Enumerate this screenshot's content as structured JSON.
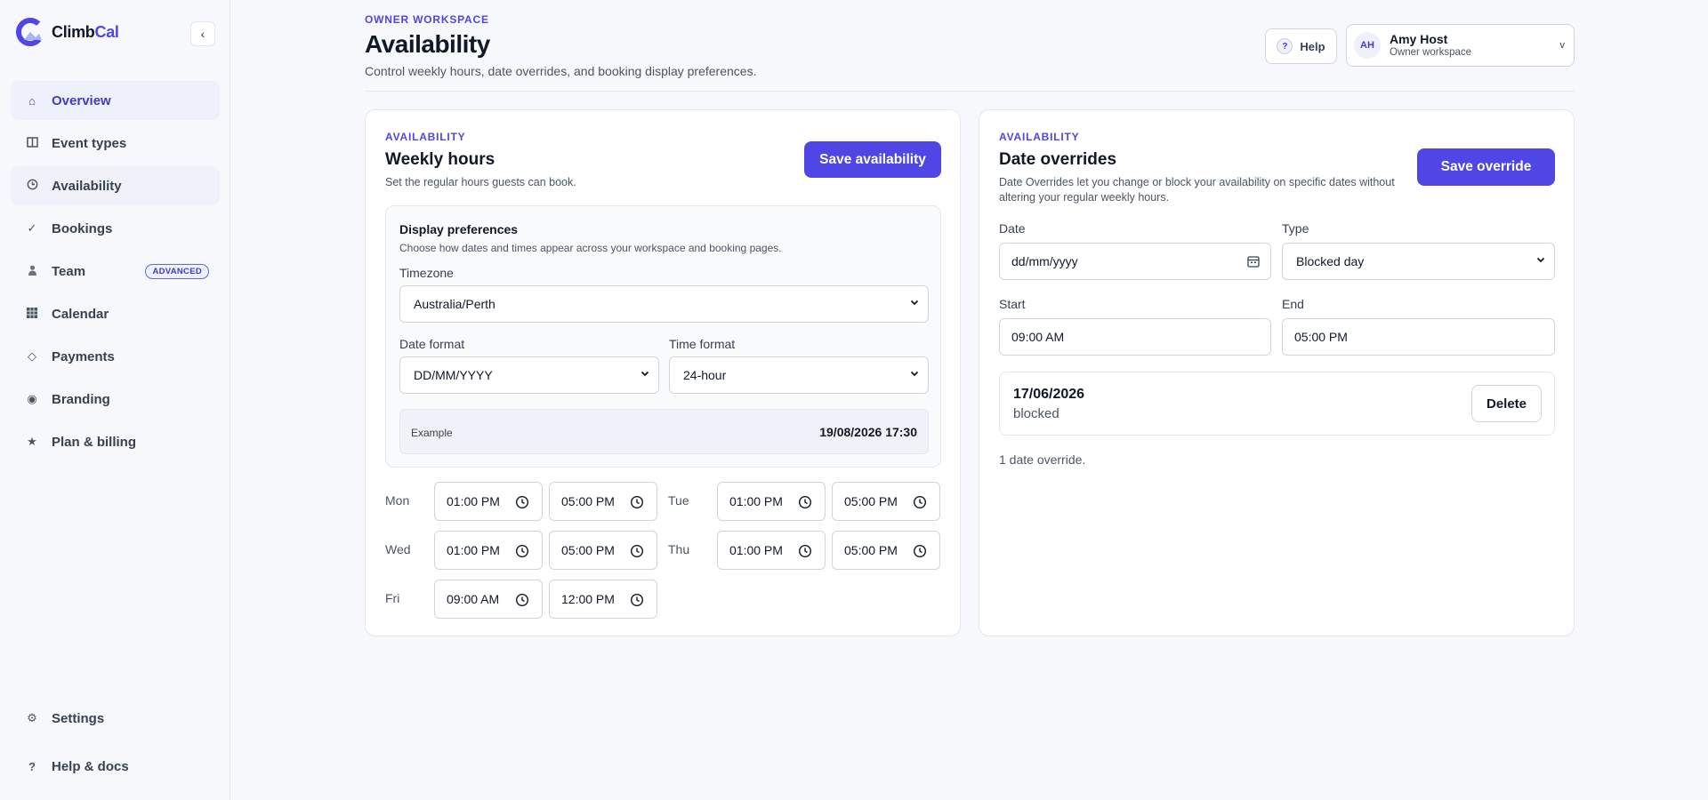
{
  "brand": {
    "name_part1": "Climb",
    "name_part2": "Cal",
    "collapse_icon": "chevron-left-icon"
  },
  "sidebar": {
    "items": [
      {
        "label": "Overview",
        "icon": "home-icon",
        "state": "active"
      },
      {
        "label": "Event types",
        "icon": "book-icon"
      },
      {
        "label": "Availability",
        "icon": "clock-icon",
        "state": "selected"
      },
      {
        "label": "Bookings",
        "icon": "check-icon"
      },
      {
        "label": "Team",
        "icon": "user-icon",
        "badge": "ADVANCED"
      },
      {
        "label": "Calendar",
        "icon": "grid-icon"
      },
      {
        "label": "Payments",
        "icon": "diamond-icon"
      },
      {
        "label": "Branding",
        "icon": "target-icon"
      },
      {
        "label": "Plan & billing",
        "icon": "star-icon"
      }
    ],
    "bottom_items": [
      {
        "label": "Settings",
        "icon": "gear-icon"
      },
      {
        "label": "Help & docs",
        "icon": "question-icon"
      }
    ]
  },
  "header": {
    "eyebrow": "OWNER WORKSPACE",
    "title": "Availability",
    "subtitle": "Control weekly hours, date overrides, and booking display preferences.",
    "help_label": "Help",
    "help_glyph": "?",
    "account": {
      "initials": "AH",
      "name": "Amy Host",
      "role": "Owner workspace",
      "chevron": "v"
    }
  },
  "weekly": {
    "eyebrow": "AVAILABILITY",
    "title": "Weekly hours",
    "description": "Set the regular hours guests can book.",
    "save_label": "Save availability",
    "prefs": {
      "title": "Display preferences",
      "description": "Choose how dates and times appear across your workspace and booking pages.",
      "timezone_label": "Timezone",
      "timezone_value": "Australia/Perth",
      "date_format_label": "Date format",
      "date_format_value": "DD/MM/YYYY",
      "time_format_label": "Time format",
      "time_format_value": "24-hour",
      "example_label": "Example",
      "example_value": "19/08/2026 17:30"
    },
    "days": [
      {
        "day": "Mon",
        "start": "01:00 PM",
        "end": "05:00 PM"
      },
      {
        "day": "Tue",
        "start": "01:00 PM",
        "end": "05:00 PM"
      },
      {
        "day": "Wed",
        "start": "01:00 PM",
        "end": "05:00 PM"
      },
      {
        "day": "Thu",
        "start": "01:00 PM",
        "end": "05:00 PM"
      },
      {
        "day": "Fri",
        "start": "09:00 AM",
        "end": "12:00 PM"
      }
    ]
  },
  "overrides": {
    "eyebrow": "AVAILABILITY",
    "title": "Date overrides",
    "description_line1": "Date Overrides let you change or block your availability on specific dates without",
    "description_line2": "altering your regular weekly hours.",
    "save_label": "Save override",
    "date_label": "Date",
    "date_placeholder": "dd/mm/yyyy",
    "type_label": "Type",
    "type_value": "Blocked day",
    "start_label": "Start",
    "start_value": "09:00 AM",
    "end_label": "End",
    "end_value": "05:00 PM",
    "items": [
      {
        "date": "17/06/2026",
        "type": "blocked",
        "delete_label": "Delete"
      }
    ],
    "count_text": "1 date override."
  },
  "colors": {
    "accent": "#4f46e5",
    "background": "#f7f8fc",
    "card": "#ffffff",
    "border": "#e5e7eb"
  }
}
